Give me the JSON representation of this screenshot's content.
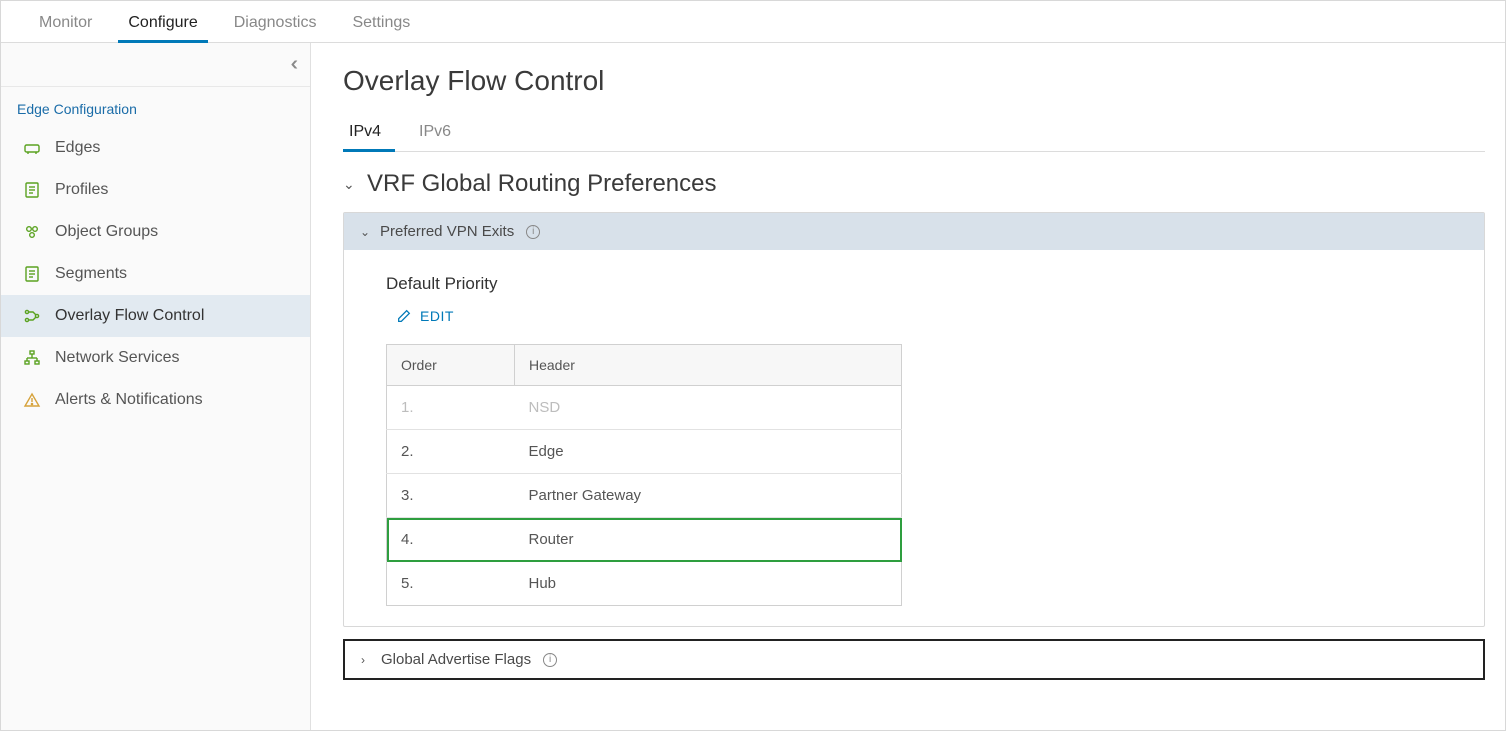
{
  "topTabs": {
    "items": [
      {
        "label": "Monitor"
      },
      {
        "label": "Configure"
      },
      {
        "label": "Diagnostics"
      },
      {
        "label": "Settings"
      }
    ],
    "activeIndex": 1
  },
  "sidebar": {
    "sectionTitle": "Edge Configuration",
    "items": [
      {
        "label": "Edges",
        "icon": "device"
      },
      {
        "label": "Profiles",
        "icon": "doc"
      },
      {
        "label": "Object Groups",
        "icon": "group"
      },
      {
        "label": "Segments",
        "icon": "doc"
      },
      {
        "label": "Overlay Flow Control",
        "icon": "flow",
        "active": true
      },
      {
        "label": "Network Services",
        "icon": "tree"
      },
      {
        "label": "Alerts & Notifications",
        "icon": "warn"
      }
    ]
  },
  "main": {
    "pageTitle": "Overlay Flow Control",
    "subTabs": {
      "items": [
        {
          "label": "IPv4"
        },
        {
          "label": "IPv6"
        }
      ],
      "activeIndex": 0
    },
    "section": {
      "title": "VRF Global Routing Preferences",
      "panelTitle": "Preferred VPN Exits",
      "priority": {
        "subtitle": "Default Priority",
        "editLabel": "EDIT",
        "columns": {
          "order": "Order",
          "header": "Header"
        },
        "rows": [
          {
            "order": "1.",
            "header": "NSD",
            "dim": true
          },
          {
            "order": "2.",
            "header": "Edge"
          },
          {
            "order": "3.",
            "header": "Partner Gateway"
          },
          {
            "order": "4.",
            "header": "Router",
            "highlight": true
          },
          {
            "order": "5.",
            "header": "Hub"
          }
        ]
      },
      "secondPanelTitle": "Global Advertise Flags"
    }
  }
}
